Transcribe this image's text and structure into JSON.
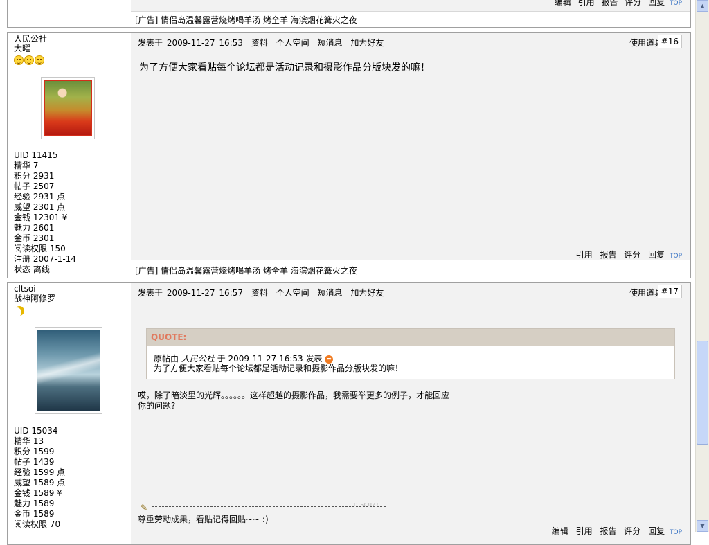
{
  "top_strip": {
    "actions": [
      "编辑",
      "引用",
      "报告",
      "评分",
      "回复",
      "TOP"
    ],
    "ad": "[广告] 情侣岛温馨露营烧烤喝羊汤 烤全羊 海滨烟花篝火之夜"
  },
  "posts": [
    {
      "username": "人民公社",
      "title": "大曜",
      "stats": [
        "UID 11415",
        "精华 7",
        "积分 2931",
        "帖子 2507",
        "经验 2931 点",
        "威望 2301 点",
        "金钱 12301 ¥",
        "魅力 2601",
        "金币 2301",
        "阅读权限 150",
        "注册 2007-1-14",
        "状态 离线"
      ],
      "meta": {
        "posted": "发表于 2009-11-27 16:53",
        "profile": "资料",
        "space": "个人空间",
        "message": "短消息",
        "friend": "加为好友"
      },
      "tools": "使用道具",
      "floor": "#16",
      "body": "为了方便大家看贴每个论坛都是活动记录和摄影作品分版块发的嘛！",
      "actions": [
        "引用",
        "报告",
        "评分",
        "回复",
        "TOP"
      ],
      "ad": "[广告] 情侣岛温馨露营烧烤喝羊汤 烤全羊 海滨烟花篝火之夜"
    },
    {
      "username": "cltsoi",
      "title": "战神阿修罗",
      "stats": [
        "UID 15034",
        "精华 13",
        "积分 1599",
        "帖子 1439",
        "经验 1599 点",
        "威望 1589 点",
        "金钱 1589 ¥",
        "魅力 1589",
        "金币 1589",
        "阅读权限 70"
      ],
      "meta": {
        "posted": "发表于 2009-11-27 16:57",
        "profile": "资料",
        "space": "个人空间",
        "message": "短消息",
        "friend": "加为好友"
      },
      "tools": "使用道具",
      "floor": "#17",
      "quote": {
        "header": "QUOTE:",
        "line1_prefix": "原帖由",
        "line1_author": "人民公社",
        "line1_suffix": "于 2009-11-27 16:53 发表",
        "line2": "为了方便大家看贴每个论坛都是活动记录和摄影作品分版块发的嘛！"
      },
      "body": "哎，除了暗淡里的光辉。。。。。。这样超越的摄影作品，我需要举更多的例子，才能回应你的问题?",
      "signature_brand": "DISCUZ!",
      "signature": "尊重劳动成果，看贴记得回贴~~ :)",
      "actions": [
        "编辑",
        "引用",
        "报告",
        "评分",
        "回复",
        "TOP"
      ]
    }
  ]
}
